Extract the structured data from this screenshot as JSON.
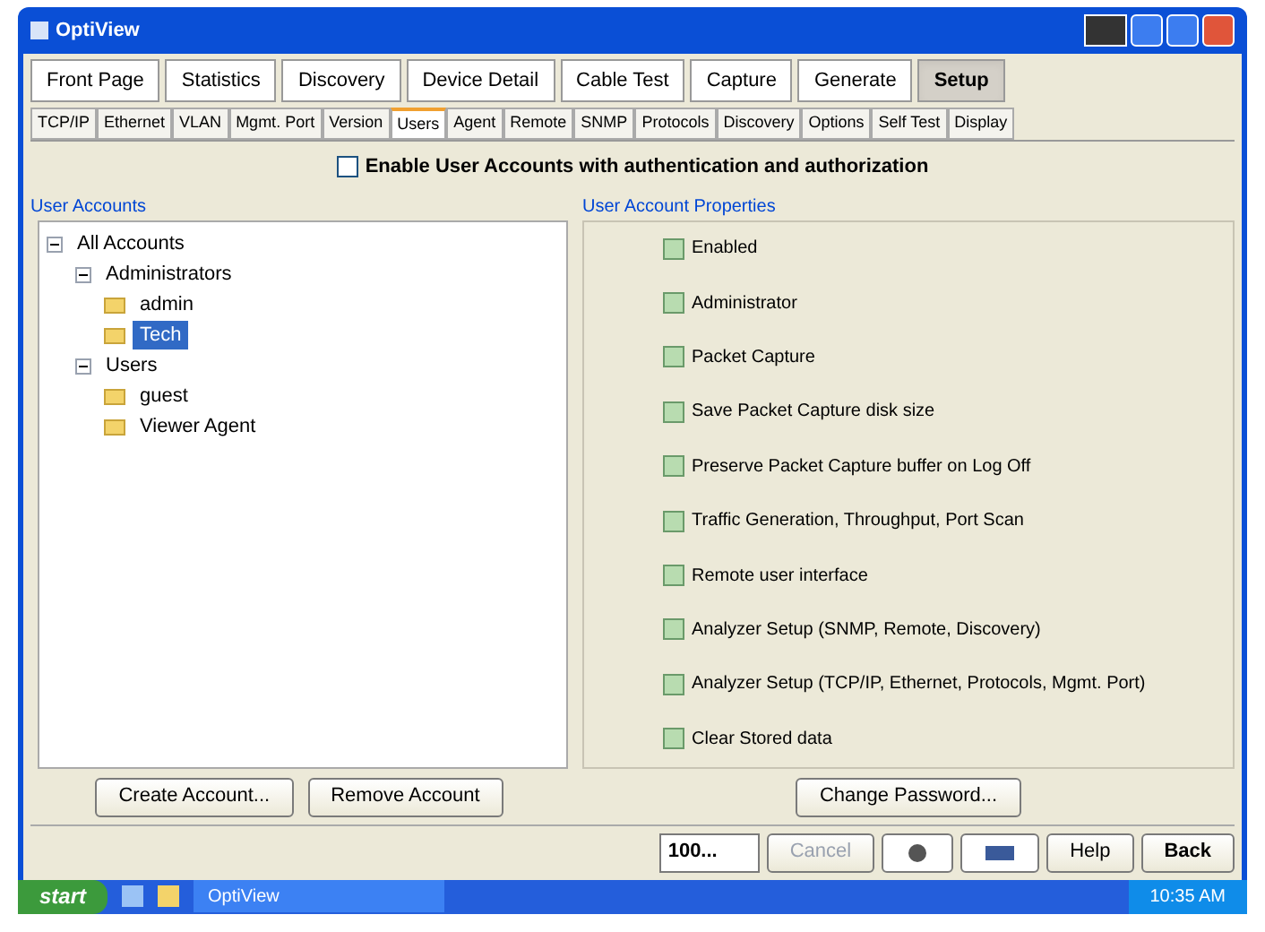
{
  "window": {
    "title": "OptiView"
  },
  "main_tabs": [
    {
      "label": "Front Page",
      "selected": false
    },
    {
      "label": "Statistics",
      "selected": false
    },
    {
      "label": "Discovery",
      "selected": false
    },
    {
      "label": "Device Detail",
      "selected": false
    },
    {
      "label": "Cable Test",
      "selected": false
    },
    {
      "label": "Capture",
      "selected": false
    },
    {
      "label": "Generate",
      "selected": false
    },
    {
      "label": "Setup",
      "selected": true
    }
  ],
  "sub_tabs": [
    {
      "label": "TCP/IP",
      "selected": false
    },
    {
      "label": "Ethernet",
      "selected": false
    },
    {
      "label": "VLAN",
      "selected": false
    },
    {
      "label": "Mgmt. Port",
      "selected": false
    },
    {
      "label": "Version",
      "selected": false
    },
    {
      "label": "Users",
      "selected": true
    },
    {
      "label": "Agent",
      "selected": false
    },
    {
      "label": "Remote",
      "selected": false
    },
    {
      "label": "SNMP",
      "selected": false
    },
    {
      "label": "Protocols",
      "selected": false
    },
    {
      "label": "Discovery",
      "selected": false
    },
    {
      "label": "Options",
      "selected": false
    },
    {
      "label": "Self Test",
      "selected": false
    },
    {
      "label": "Display",
      "selected": false
    }
  ],
  "enable_accounts": {
    "label": "Enable User Accounts with authentication and authorization",
    "checked": false
  },
  "user_accounts": {
    "title": "User Accounts",
    "tree": [
      {
        "label": "All Accounts",
        "selected": false,
        "children": [
          {
            "label": "Administrators",
            "selected": false,
            "children": [
              {
                "label": "admin",
                "selected": false
              },
              {
                "label": "Tech",
                "selected": true
              }
            ]
          },
          {
            "label": "Users",
            "selected": false,
            "children": [
              {
                "label": "guest",
                "selected": false
              },
              {
                "label": "Viewer Agent",
                "selected": false
              }
            ]
          }
        ]
      }
    ],
    "buttons": [
      "Create Account...",
      "Remove Account"
    ]
  },
  "properties": {
    "title": "User Account Properties",
    "items": [
      {
        "label": "Enabled",
        "checked": true
      },
      {
        "label": "Administrator",
        "checked": true
      },
      {
        "label": "Packet Capture",
        "checked": true
      },
      {
        "label": "Save Packet Capture disk size",
        "checked": true
      },
      {
        "label": "Preserve Packet Capture buffer on Log Off",
        "checked": true
      },
      {
        "label": "Traffic Generation, Throughput, Port Scan",
        "checked": true
      },
      {
        "label": "Remote user interface",
        "checked": true
      },
      {
        "label": "Analyzer Setup (SNMP, Remote, Discovery)",
        "checked": true
      },
      {
        "label": "Analyzer Setup (TCP/IP, Ethernet, Protocols, Mgmt. Port)",
        "checked": true
      },
      {
        "label": "Clear Stored data",
        "checked": true
      }
    ],
    "button": "Change Password..."
  },
  "bottom_bar": {
    "zoom": "100...",
    "cancel": {
      "label": "Cancel",
      "disabled": true
    },
    "help": "Help",
    "back": "Back"
  },
  "taskbar": {
    "start": "start",
    "task": "OptiView",
    "clock": "10:35 AM"
  }
}
